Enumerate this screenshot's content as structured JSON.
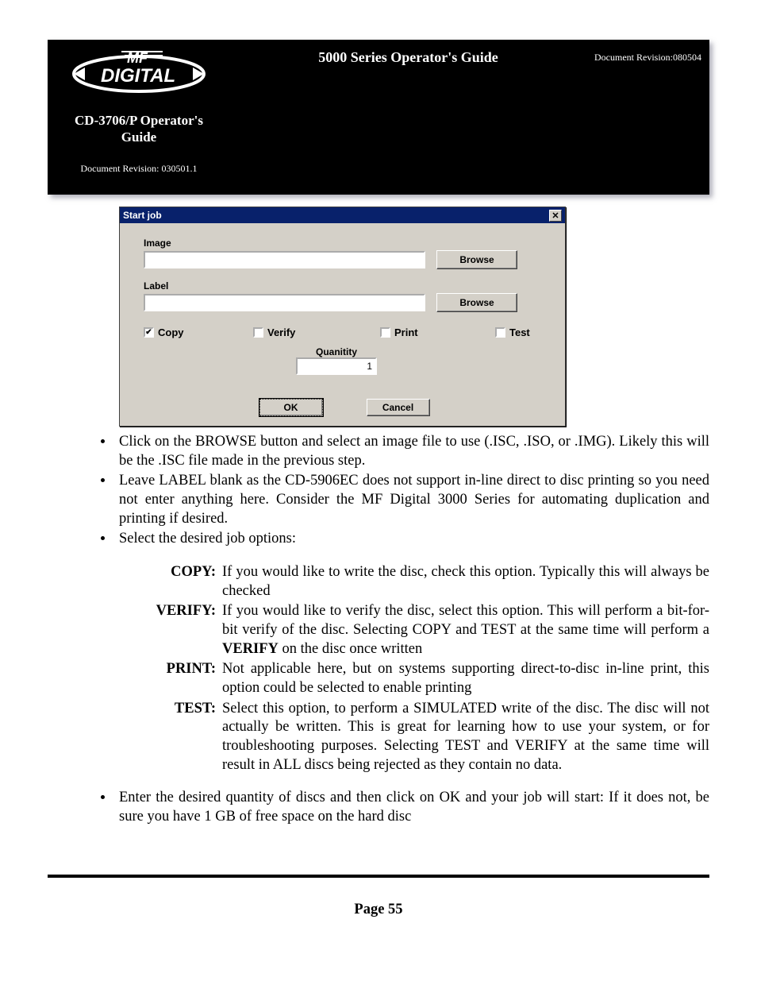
{
  "header": {
    "product_guide": "CD-3706/P Operator's Guide",
    "left_revision": "Document Revision: 030501.1",
    "center_title": "5000 Series Operator's Guide",
    "right_revision": "Document Revision:080504",
    "logo_top": "MF",
    "logo_bottom": "DIGITAL"
  },
  "dialog": {
    "title": "Start job",
    "image_label": "Image",
    "label_label": "Label",
    "browse": "Browse",
    "image_value": "",
    "label_value": "",
    "checks": {
      "copy": {
        "label": "Copy",
        "checked": true
      },
      "verify": {
        "label": "Verify",
        "checked": false
      },
      "print": {
        "label": "Print",
        "checked": false
      },
      "test": {
        "label": "Test",
        "checked": false
      }
    },
    "quantity_label": "Quanitity",
    "quantity_value": "1",
    "ok": "OK",
    "cancel": "Cancel"
  },
  "content": {
    "bullet1": "Click on the BROWSE button and select an image file to use (.ISC, .ISO, or .IMG). Likely this will be the .ISC file made in the previous step.",
    "bullet2": "Leave LABEL blank as the CD-5906EC does not support in-line direct to disc printing so you need not enter anything here. Consider the MF Digital 3000 Series for automating duplication and printing if desired.",
    "bullet3": "Select the desired job options:",
    "bullet4": "Enter the desired quantity of discs and then click on OK and your job will start: If it does not, be sure you have 1 GB of free space on the hard disc",
    "defs": {
      "copy_term": "COPY:",
      "copy_body": "If you would like to write the disc, check this option. Typically this will always be checked",
      "verify_term": "VERIFY:",
      "verify_body_pre": "If you would like to verify the disc, select this option. This will perform a bit-for-bit verify of the disc. Selecting COPY and TEST at the same time will perform a ",
      "verify_bold": "VERIFY",
      "verify_body_post": " on the disc once written",
      "print_term": "PRINT:",
      "print_body": "Not applicable here, but on systems supporting direct-to-disc in-line print, this option could be selected to enable printing",
      "test_term": "TEST:",
      "test_body": "Select this option, to perform a SIMULATED write of the disc. The disc will not actually be written. This is great for learning how to use your system, or for troubleshooting purposes. Selecting TEST and VERIFY at the same time will result in ALL discs being rejected as they contain no data."
    }
  },
  "page_number": "Page 55"
}
